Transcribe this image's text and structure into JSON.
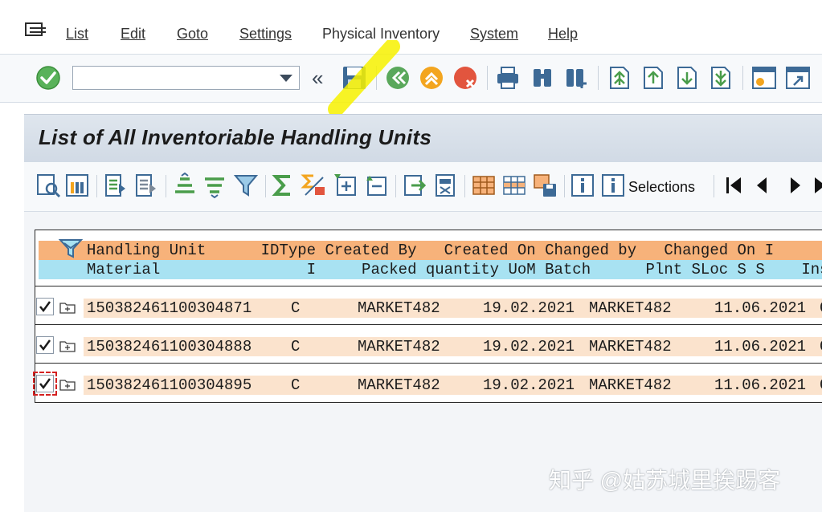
{
  "menu": {
    "items": [
      {
        "label": "List"
      },
      {
        "label": "Edit"
      },
      {
        "label": "Goto"
      },
      {
        "label": "Settings"
      },
      {
        "label": "Physical Inventory"
      },
      {
        "label": "System"
      },
      {
        "label": "Help"
      }
    ]
  },
  "toolbar": {
    "command_value": "",
    "back_glyph": "«"
  },
  "page": {
    "title": "List of All Inventoriable Handling Units"
  },
  "alv": {
    "selections_label": "Selections"
  },
  "list": {
    "header1": "Handling Unit      IDType Created By   Created On Changed by   Changed On I",
    "header2": "Material                I     Packed quantity UoM Batch      Plnt SLoc S S    Insp",
    "rows": [
      {
        "handling_unit": "150382461100304871",
        "idtype": "C",
        "created_by": "MARKET482",
        "created_on": "19.02.2021",
        "changed_by": "MARKET482",
        "changed_on": "11.06.2021",
        "trail": "C",
        "checked": true
      },
      {
        "handling_unit": "150382461100304888",
        "idtype": "C",
        "created_by": "MARKET482",
        "created_on": "19.02.2021",
        "changed_by": "MARKET482",
        "changed_on": "11.06.2021",
        "trail": "C",
        "checked": true
      },
      {
        "handling_unit": "150382461100304895",
        "idtype": "C",
        "created_by": "MARKET482",
        "created_on": "19.02.2021",
        "changed_by": "MARKET482",
        "changed_on": "11.06.2021",
        "trail": "C",
        "checked": true
      }
    ]
  },
  "watermark": "知乎 @姑苏城里挨踢客",
  "colors": {
    "header_orange": "#f7b27a",
    "header_blue": "#a8e2f2",
    "row_bg": "#fbe3cd",
    "green_ok": "#4caf50",
    "orange_icon": "#f39c12",
    "red_icon": "#e74c3c"
  }
}
